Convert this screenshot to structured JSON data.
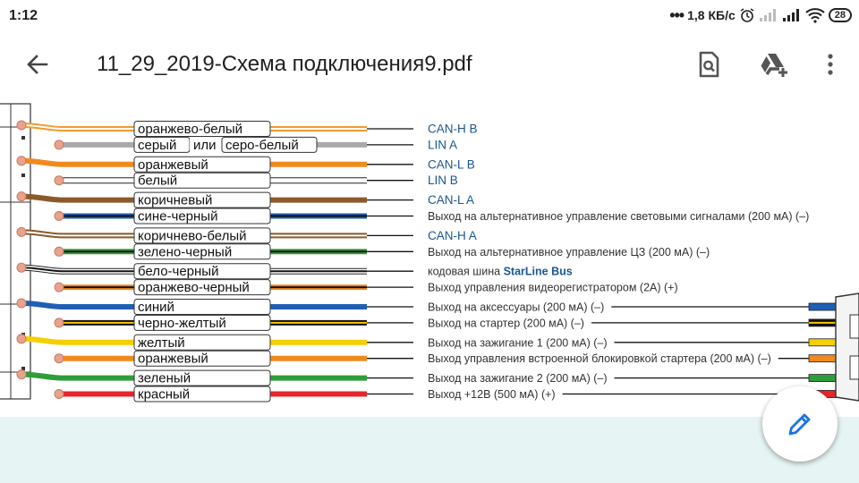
{
  "status": {
    "time": "1:12",
    "speed": "1,8 КБ/с",
    "battery": "28"
  },
  "appbar": {
    "title": "11_29_2019-Схема подключения9.pdf",
    "icons": [
      "arrow-back-icon",
      "find-in-document-icon",
      "drive-add-icon",
      "more-vert-icon"
    ]
  },
  "wires": [
    {
      "label": "оранжево-белый",
      "color": "#f39a2b",
      "stripe": "#ffffff",
      "desc": "CAN-H B",
      "kind": "can"
    },
    {
      "label": "серый",
      "or": "или",
      "label2": "серо-белый",
      "color": "#a9a9a9",
      "stripe": "",
      "desc": "LIN A",
      "kind": "can"
    },
    {
      "label": "оранжевый",
      "color": "#f08a1e",
      "stripe": "",
      "desc": "CAN-L B",
      "kind": "can"
    },
    {
      "label": "белый",
      "color": "#ffffff",
      "stripe": "",
      "desc": "LIN B",
      "kind": "can"
    },
    {
      "label": "коричневый",
      "color": "#8b5a2b",
      "stripe": "",
      "desc": "CAN-L A",
      "kind": "can"
    },
    {
      "label": "сине-черный",
      "color": "#1f5fb4",
      "stripe": "#111111",
      "desc": "Выход на альтернативное управление световыми сигналами (200 мА) (–)",
      "kind": "plain"
    },
    {
      "label": "коричнево-белый",
      "color": "#8b5a2b",
      "stripe": "#ffffff",
      "desc": "CAN-H A",
      "kind": "can"
    },
    {
      "label": "зелено-черный",
      "color": "#2e9e3a",
      "stripe": "#111111",
      "desc": "Выход на альтернативное управление ЦЗ (200 мА) (–)",
      "kind": "plain"
    },
    {
      "label": "бело-черный",
      "color": "#ffffff",
      "stripe": "#111111",
      "desc": "кодовая шина",
      "desc2": "StarLine Bus",
      "kind": "bus"
    },
    {
      "label": "оранжево-черный",
      "color": "#f08a1e",
      "stripe": "#111111",
      "desc": "Выход управления видеорегистратором (2А) (+)",
      "kind": "plain"
    },
    {
      "label": "синий",
      "color": "#1f5fb4",
      "stripe": "",
      "desc": "Выход на аксессуары (200 мА) (–)",
      "kind": "plain",
      "end": "#1f5fb4"
    },
    {
      "label": "черно-желтый",
      "color": "#111111",
      "stripe": "#f5c400",
      "desc": "Выход на стартер (200 мА) (–)",
      "kind": "plain",
      "end": "#111111",
      "endStripe": "#f5c400"
    },
    {
      "label": "желтый",
      "color": "#f5cf00",
      "stripe": "",
      "desc": "Выход на зажигание 1 (200 мА) (–)",
      "kind": "plain",
      "end": "#f5cf00"
    },
    {
      "label": "оранжевый",
      "color": "#f08a1e",
      "stripe": "",
      "desc": "Выход управления встроенной блокировкой стартера (200 мА) (–)",
      "kind": "plain",
      "end": "#f08a1e"
    },
    {
      "label": "зеленый",
      "color": "#2e9e3a",
      "stripe": "",
      "desc": "Выход на зажигание 2 (200 мА) (–)",
      "kind": "plain",
      "end": "#2e9e3a"
    },
    {
      "label": "красный",
      "color": "#e8252b",
      "stripe": "",
      "desc": "Выход +12В (500 мА) (+)",
      "kind": "plain",
      "end": "#e8252b"
    }
  ],
  "fab": {
    "icon": "edit-pencil-icon"
  },
  "colors": {
    "accent": "#1a73e8",
    "can_text": "#1a5690",
    "bottom_bg": "#e6f4f3"
  }
}
